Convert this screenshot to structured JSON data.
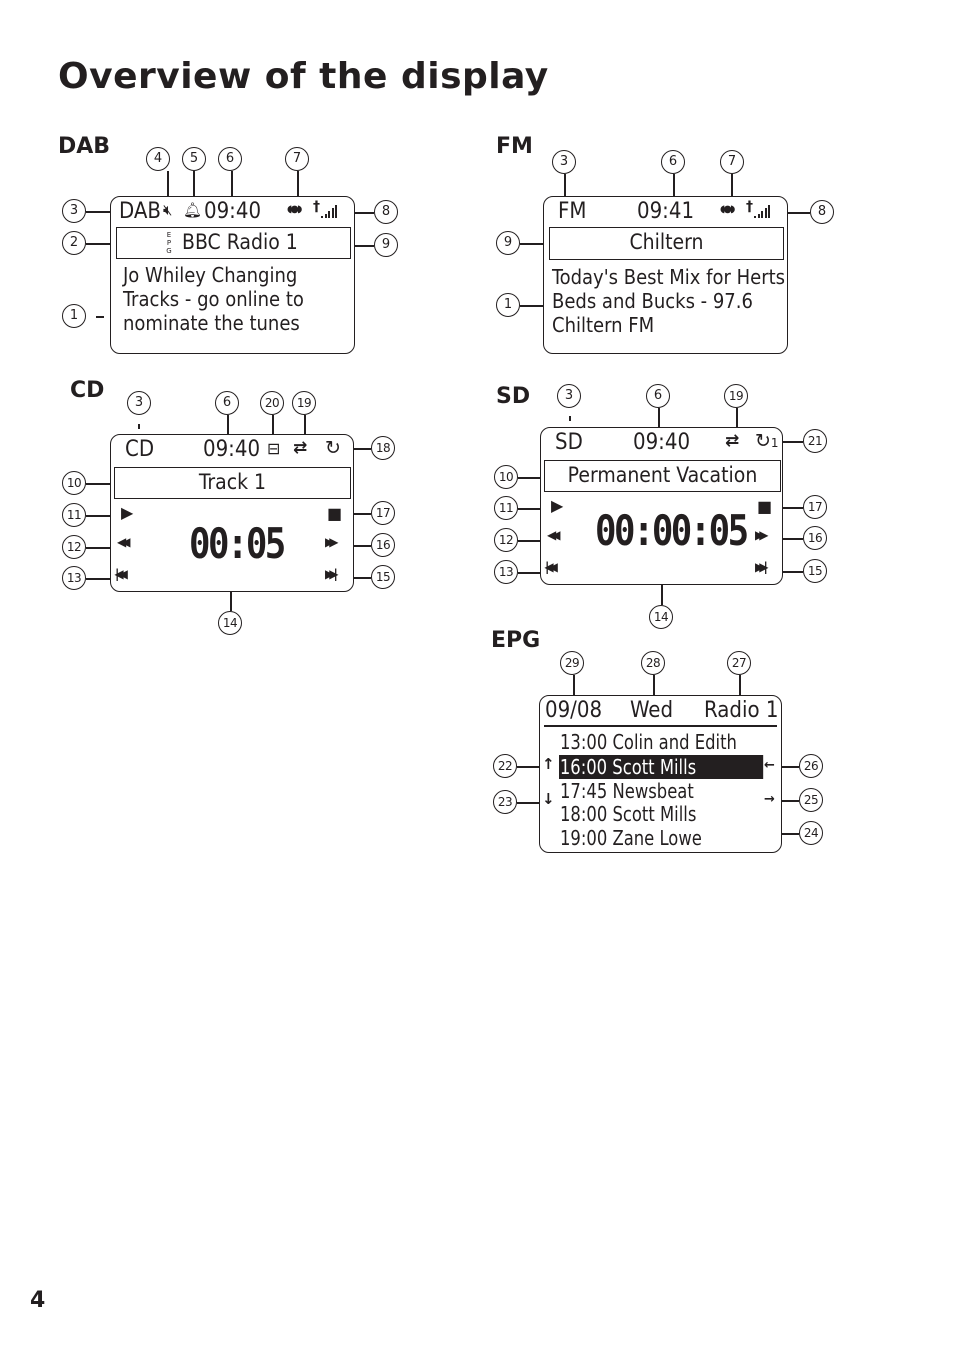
{
  "page": {
    "title": "Overview of the display",
    "number": "4"
  },
  "dab": {
    "label": "DAB",
    "mode": "DAB",
    "time": "09:40",
    "epg_mark": "EPG",
    "station": "BBC Radio 1",
    "text_lines": [
      "Jo Whiley Changing",
      "Tracks  - go online to",
      "nominate the tunes"
    ],
    "callouts": [
      "1",
      "2",
      "3",
      "4",
      "5",
      "6",
      "7",
      "8",
      "9"
    ],
    "icons": [
      "mute-icon",
      "alarm-bell-icon",
      "stereo-icon",
      "antenna-signal-icon",
      "epg-icon"
    ]
  },
  "fm": {
    "label": "FM",
    "mode": "FM",
    "time": "09:41",
    "station": "Chiltern",
    "text_lines": [
      "Today's Best Mix for Herts",
      "Beds and Bucks - 97.6",
      "Chiltern FM"
    ],
    "callouts": [
      "1",
      "3",
      "6",
      "7",
      "8",
      "9"
    ],
    "icons": [
      "stereo-icon",
      "antenna-signal-icon"
    ]
  },
  "cd": {
    "label": "CD",
    "mode": "CD",
    "time": "09:40",
    "track": "Track 1",
    "elapsed": "00:05",
    "callouts": [
      "3",
      "6",
      "20",
      "19",
      "18",
      "10",
      "11",
      "12",
      "13",
      "14",
      "15",
      "16",
      "17"
    ],
    "icons": [
      "folder-icon",
      "shuffle-icon",
      "repeat-icon",
      "play-icon",
      "rewind-icon",
      "previous-track-icon",
      "stop-icon",
      "fast-forward-icon",
      "next-track-icon"
    ]
  },
  "sd": {
    "label": "SD",
    "mode": "SD",
    "time": "09:40",
    "track": "Permanent Vacation",
    "elapsed": "00:00:05",
    "repeat_one": "1",
    "callouts": [
      "3",
      "6",
      "19",
      "21",
      "10",
      "11",
      "12",
      "13",
      "14",
      "15",
      "16",
      "17"
    ],
    "icons": [
      "shuffle-icon",
      "repeat-one-icon",
      "play-icon",
      "rewind-icon",
      "previous-track-icon",
      "stop-icon",
      "fast-forward-icon",
      "next-track-icon"
    ]
  },
  "epg": {
    "label": "EPG",
    "date": "09/08",
    "day": "Wed",
    "station": "Radio 1",
    "rows": [
      {
        "text": "13:00 Colin and Edith",
        "selected": false
      },
      {
        "text": "16:00 Scott Mills",
        "selected": true
      },
      {
        "text": "17:45 Newsbeat",
        "selected": false
      },
      {
        "text": "18:00 Scott Mills",
        "selected": false
      },
      {
        "text": "19:00 Zane Lowe",
        "selected": false
      }
    ],
    "callouts": [
      "29",
      "28",
      "27",
      "22",
      "23",
      "26",
      "25",
      "24"
    ],
    "icons": [
      "scroll-up-arrow-icon",
      "scroll-down-arrow-icon",
      "back-arrow-icon",
      "forward-arrow-icon"
    ]
  },
  "glyphs": {
    "mute": "🔇︎",
    "bell": "🔔︎",
    "stereo": "◖●◗",
    "antenna": "†",
    "play": "▶",
    "rewind": "◀◀",
    "prev": "|◀◀",
    "stop": "■",
    "ff": "▶▶",
    "next": "▶▶|",
    "folder": "⊟",
    "shuffle": "⇄",
    "repeat": "↻",
    "up": "↑",
    "down": "↓",
    "left": "←",
    "right": "→"
  }
}
